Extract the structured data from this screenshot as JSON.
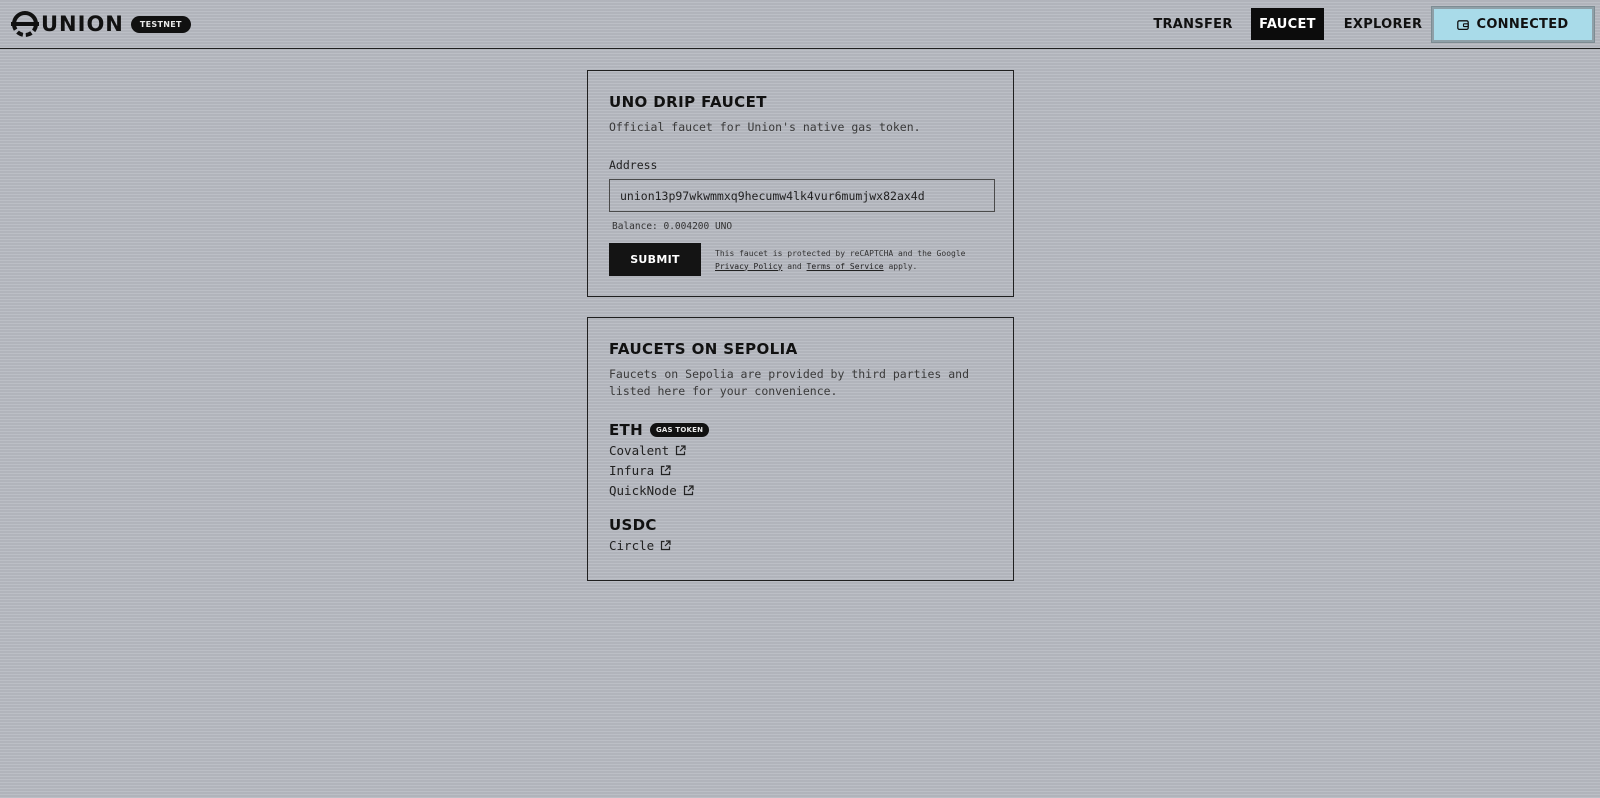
{
  "header": {
    "brand": "UNION",
    "network_badge": "TESTNET",
    "nav": [
      {
        "label": "TRANSFER",
        "active": false
      },
      {
        "label": "FAUCET",
        "active": true
      },
      {
        "label": "EXPLORER",
        "active": false
      }
    ],
    "wallet_button": {
      "label": "CONNECTED",
      "icon": "wallet-icon",
      "color": "#a9dbe9"
    }
  },
  "drip_faucet": {
    "title": "UNO DRIP FAUCET",
    "description": "Official faucet for Union's native gas token.",
    "address_label": "Address",
    "address_value": "union13p97wkwmmxq9hecumw4lk4vur6mumjwx82ax4d",
    "balance": "Balance: 0.004200 UNO",
    "submit_label": "SUBMIT",
    "recaptcha": {
      "prefix": "This faucet is protected by reCAPTCHA and the Google",
      "privacy_label": "Privacy Policy",
      "conjunction": "and",
      "terms_label": "Terms of Service",
      "suffix": "apply."
    }
  },
  "sepolia_faucets": {
    "title": "FAUCETS ON SEPOLIA",
    "description": "Faucets on Sepolia are provided by third parties and listed here for your convenience.",
    "tokens": [
      {
        "name": "ETH",
        "badge": "GAS TOKEN",
        "links": [
          "Covalent",
          "Infura",
          "QuickNode"
        ]
      },
      {
        "name": "USDC",
        "badge": "",
        "links": [
          "Circle"
        ]
      }
    ]
  }
}
